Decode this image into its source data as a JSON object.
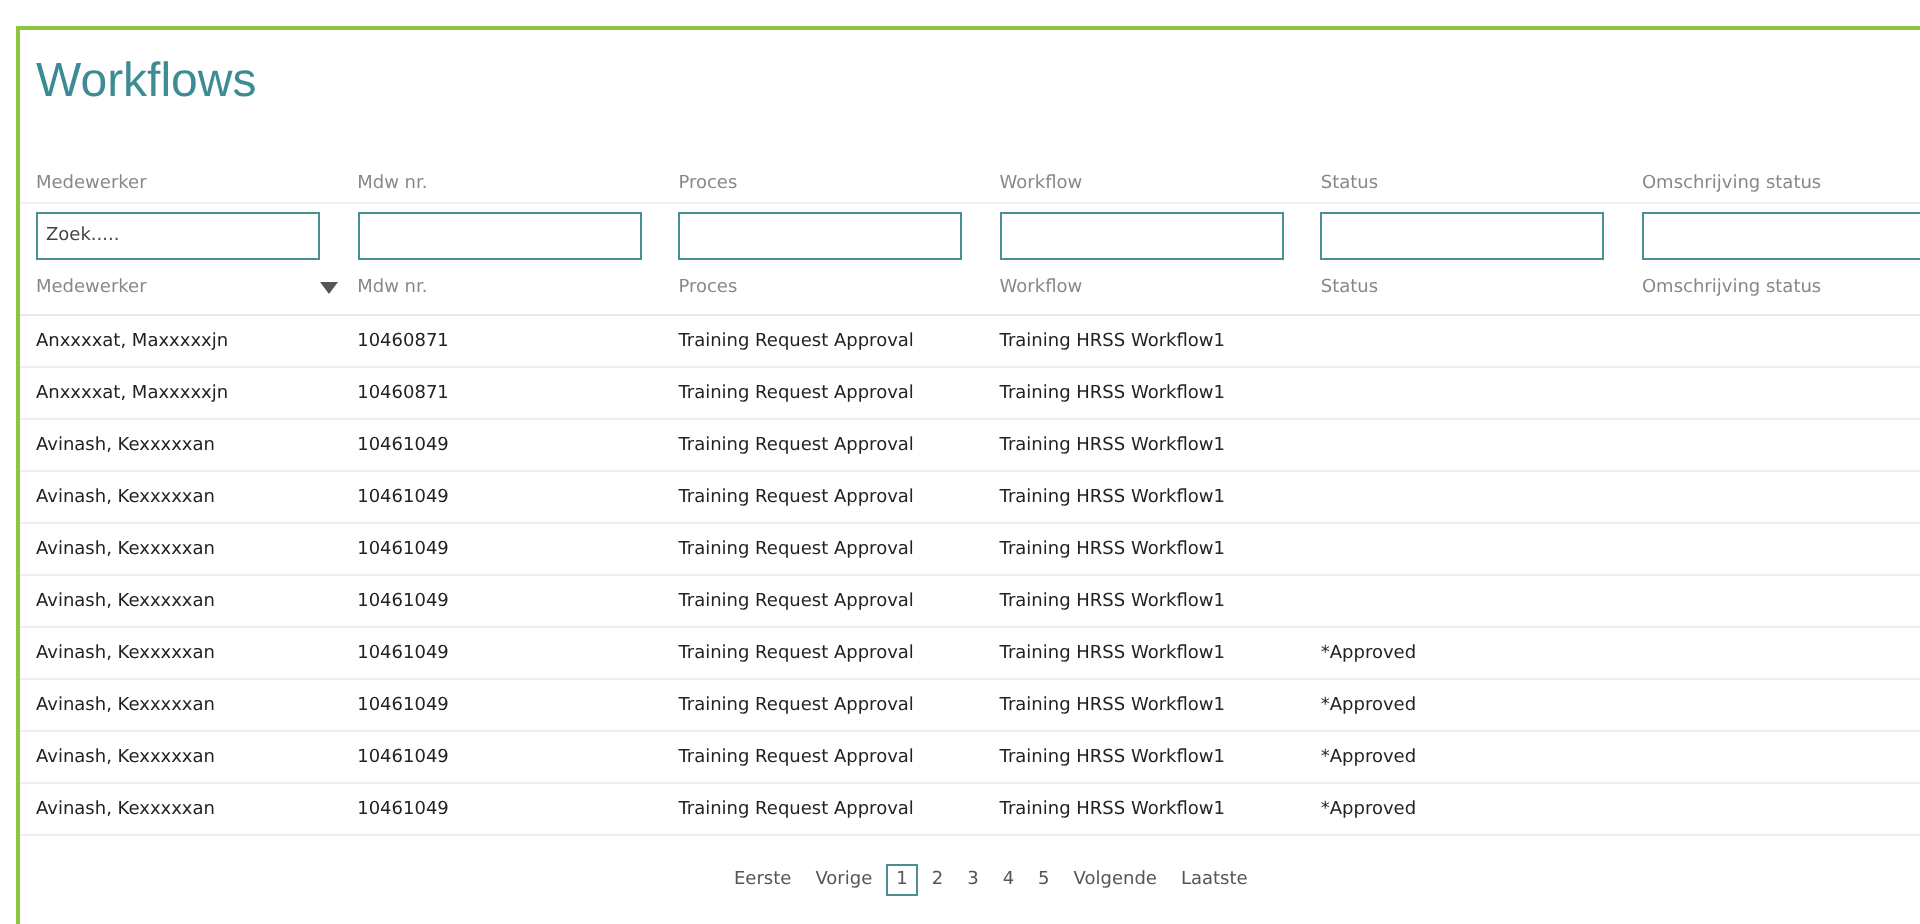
{
  "title": "Workflows",
  "filters": [
    {
      "label": "Medewerker",
      "placeholder": "Zoek....."
    },
    {
      "label": "Mdw nr."
    },
    {
      "label": "Proces"
    },
    {
      "label": "Workflow"
    },
    {
      "label": "Status"
    },
    {
      "label": "Omschrijving status"
    }
  ],
  "table": {
    "columns": [
      {
        "label": "Medewerker",
        "sorted": true
      },
      {
        "label": "Mdw nr.",
        "sorted": false
      },
      {
        "label": "Proces",
        "sorted": false
      },
      {
        "label": "Workflow",
        "sorted": false
      },
      {
        "label": "Status",
        "sorted": false
      },
      {
        "label": "Omschrijving status",
        "sorted": false
      }
    ],
    "rows": [
      [
        "Anxxxxat, Maxxxxxjn",
        "10460871",
        "Training Request Approval",
        "Training HRSS Workflow1",
        "",
        ""
      ],
      [
        "Anxxxxat, Maxxxxxjn",
        "10460871",
        "Training Request Approval",
        "Training HRSS Workflow1",
        "",
        ""
      ],
      [
        "Avinash, Kexxxxxan",
        "10461049",
        "Training Request Approval",
        "Training HRSS Workflow1",
        "",
        ""
      ],
      [
        "Avinash, Kexxxxxan",
        "10461049",
        "Training Request Approval",
        "Training HRSS Workflow1",
        "",
        ""
      ],
      [
        "Avinash, Kexxxxxan",
        "10461049",
        "Training Request Approval",
        "Training HRSS Workflow1",
        "",
        ""
      ],
      [
        "Avinash, Kexxxxxan",
        "10461049",
        "Training Request Approval",
        "Training HRSS Workflow1",
        "",
        ""
      ],
      [
        "Avinash, Kexxxxxan",
        "10461049",
        "Training Request Approval",
        "Training HRSS Workflow1",
        "*Approved",
        ""
      ],
      [
        "Avinash, Kexxxxxan",
        "10461049",
        "Training Request Approval",
        "Training HRSS Workflow1",
        "*Approved",
        ""
      ],
      [
        "Avinash, Kexxxxxan",
        "10461049",
        "Training Request Approval",
        "Training HRSS Workflow1",
        "*Approved",
        ""
      ],
      [
        "Avinash, Kexxxxxan",
        "10461049",
        "Training Request Approval",
        "Training HRSS Workflow1",
        "*Approved",
        ""
      ]
    ]
  },
  "pagination": [
    {
      "label": "Eerste",
      "selected": false
    },
    {
      "label": "Vorige",
      "selected": false
    },
    {
      "label": "1",
      "selected": true
    },
    {
      "label": "2",
      "selected": false
    },
    {
      "label": "3",
      "selected": false
    },
    {
      "label": "4",
      "selected": false
    },
    {
      "label": "5",
      "selected": false
    },
    {
      "label": "Volgende",
      "selected": false
    },
    {
      "label": "Laatste",
      "selected": false
    }
  ]
}
